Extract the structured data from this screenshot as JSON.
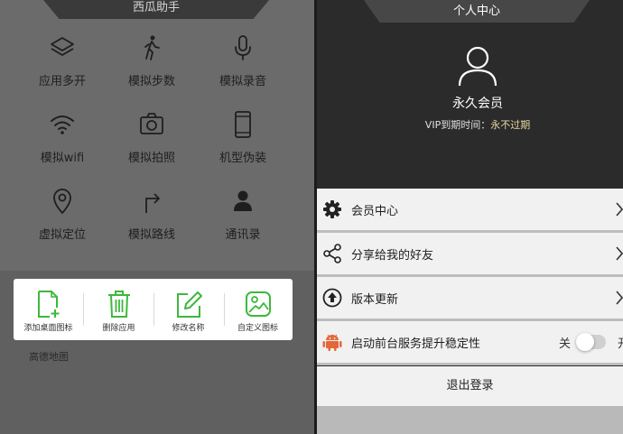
{
  "left": {
    "title": "西瓜助手",
    "tools": [
      {
        "label": "应用多开",
        "icon": "layers-icon"
      },
      {
        "label": "模拟步数",
        "icon": "walking-person-icon"
      },
      {
        "label": "模拟录音",
        "icon": "microphone-icon"
      },
      {
        "label": "模拟wifi",
        "icon": "wifi-icon"
      },
      {
        "label": "模拟拍照",
        "icon": "camera-icon"
      },
      {
        "label": "机型伪装",
        "icon": "phone-device-icon"
      },
      {
        "label": "虚拟定位",
        "icon": "location-pin-icon"
      },
      {
        "label": "模拟路线",
        "icon": "route-arrow-icon"
      },
      {
        "label": "通讯录",
        "icon": "contact-person-icon"
      }
    ],
    "popup": [
      {
        "label": "添加桌面图标",
        "icon": "add-shortcut-icon"
      },
      {
        "label": "删除应用",
        "icon": "trash-icon"
      },
      {
        "label": "修改名称",
        "icon": "edit-icon"
      },
      {
        "label": "自定义图标",
        "icon": "image-icon"
      }
    ],
    "map_label": "高德地图",
    "accent": "#3db83d"
  },
  "right": {
    "title": "个人中心",
    "member_title": "永久会员",
    "vip_label": "VIP到期时间：",
    "vip_value": "永不过期",
    "menu": [
      {
        "label": "会员中心",
        "icon": "gear-icon"
      },
      {
        "label": "分享给我的好友",
        "icon": "share-icon"
      },
      {
        "label": "版本更新",
        "icon": "upload-circle-icon"
      },
      {
        "label": "启动前台服务提升稳定性",
        "icon": "android-icon"
      }
    ],
    "toggle_off_label": "关",
    "toggle_on_label_cut": "开",
    "logout": "退出登录"
  }
}
